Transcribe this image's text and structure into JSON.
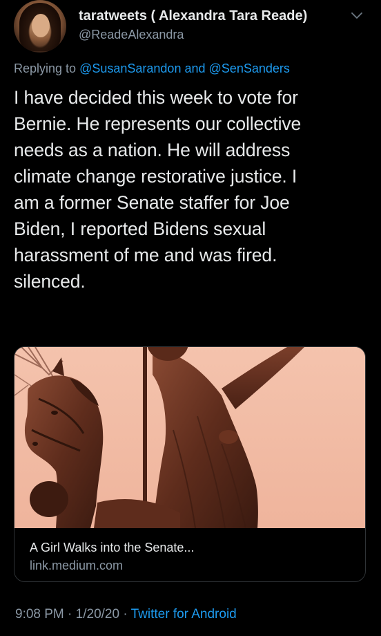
{
  "author": {
    "display_name": "taratweets ( Alexandra Tara Reade)",
    "handle": "@ReadeAlexandra",
    "avatar_icon": "profile-photo"
  },
  "reply": {
    "prefix": "Replying to",
    "mention_1": "@SusanSarandon",
    "joiner": "and",
    "mention_2": "@SenSanders"
  },
  "tweet": {
    "lines": [
      "I have decided this week to vote for",
      "Bernie. He represents our collective",
      "needs as a nation. He will address",
      "climate change restorative justice. I",
      "am a former Senate staffer for Joe",
      "Biden, I reported Bidens sexual",
      "harassment of me and was fired.",
      "silenced."
    ]
  },
  "link_card": {
    "title": "A Girl Walks into the Senate...",
    "domain": "link.medium.com",
    "image_icon": "statue-photo"
  },
  "footer": {
    "time": "9:08 PM",
    "sep_1": "·",
    "date": "1/20/20",
    "sep_2": "·",
    "source": "Twitter for Android"
  },
  "colors": {
    "background": "#000000",
    "text": "#e7e9ea",
    "secondary": "#8b98a5",
    "accent": "#1d9bf0",
    "card_image_tint": "#f3bda6"
  },
  "menu_icon": "chevron-down-icon"
}
